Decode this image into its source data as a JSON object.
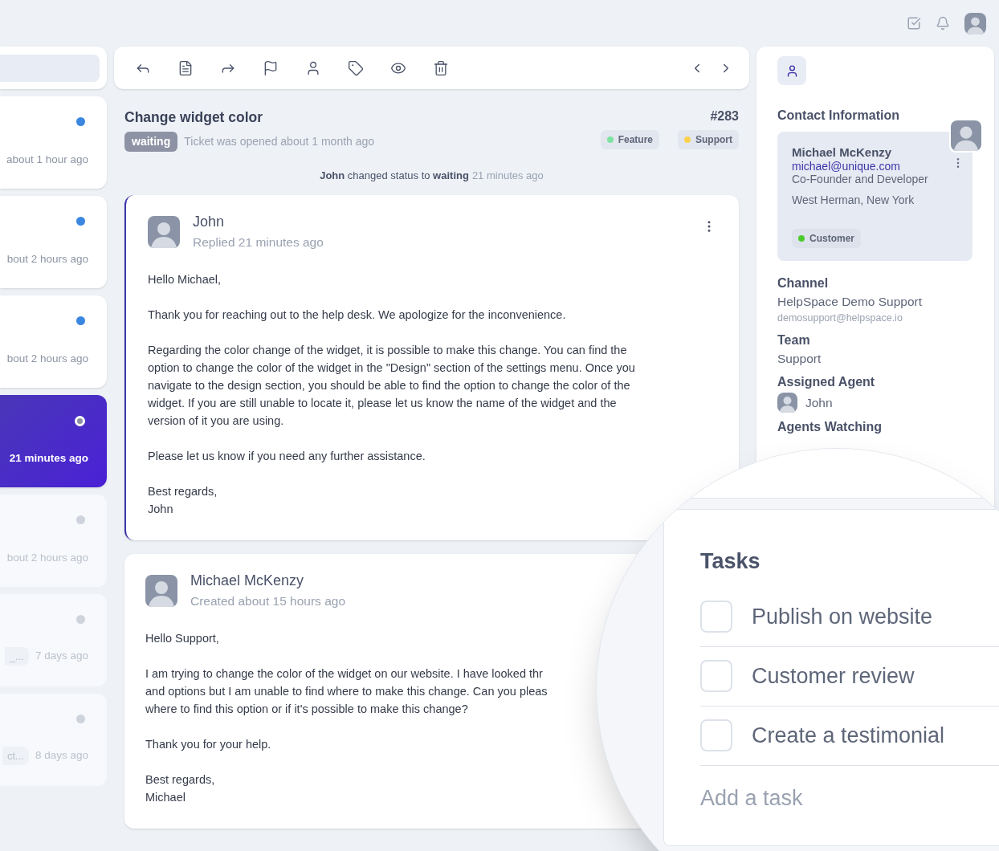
{
  "ticket_list": [
    {
      "time": "about 1 hour ago",
      "unread": true,
      "selected": false
    },
    {
      "time": "bout 2 hours ago",
      "unread": true,
      "selected": false
    },
    {
      "time": "bout 2 hours ago",
      "unread": true,
      "selected": false
    },
    {
      "time": "21 minutes ago",
      "unread": false,
      "selected": true
    },
    {
      "time": "bout 2 hours ago",
      "unread": false,
      "selected": false
    },
    {
      "time": "7 days ago",
      "chip": "_...",
      "unread": false,
      "selected": false
    },
    {
      "time": "8 days ago",
      "chip": "ct...",
      "unread": false,
      "selected": false
    }
  ],
  "ticket": {
    "title": "Change widget color",
    "status": "waiting",
    "opened": "Ticket was opened about 1 month ago",
    "number": "#283",
    "tags": [
      {
        "label": "Feature",
        "color": "#7ee2a0"
      },
      {
        "label": "Support",
        "color": "#fcd14d"
      }
    ]
  },
  "activity": {
    "text": "**John** changed status to **waiting**",
    "time": "21 minutes ago"
  },
  "messages": [
    {
      "kind": "reply",
      "author": "John",
      "time": "Replied 21 minutes ago",
      "paragraphs": [
        [
          "Hello Michael,"
        ],
        [
          "Thank you for reaching out to the help desk. We apologize for the inconvenience."
        ],
        [
          "Regarding the color change of the widget, it is possible to make this change. You can find the",
          "option to change the color of the widget in the \"Design\" section of the settings menu. Once you",
          "navigate to the design section, you should be able to find the option to change the color of the",
          "widget. If you are still unable to locate it, please let us know the name of the widget and the",
          "version of it you are using."
        ],
        [
          "Please let us know if you need any further assistance."
        ],
        [
          "Best regards,",
          "John"
        ]
      ]
    },
    {
      "kind": "customer",
      "author": "Michael McKenzy",
      "time": "Created about 15 hours ago",
      "paragraphs": [
        [
          "Hello Support,"
        ],
        [
          "I am trying to change the color of the widget on our website. I have looked thr",
          "and options but I am unable to find where to make this change. Can you pleas",
          "where to find this option or if it's possible to make this change?"
        ],
        [
          "Thank you for your help."
        ],
        [
          "Best regards,",
          "Michael"
        ]
      ]
    }
  ],
  "contact": {
    "title": "Contact Information",
    "name": "Michael McKenzy",
    "email": "michael@unique.com",
    "role": "Co-Founder and Developer",
    "location": "West Herman, New York",
    "tag": {
      "label": "Customer",
      "color": "#4ccb2f"
    }
  },
  "details": [
    {
      "kind": "text",
      "label": "Channel",
      "value": "HelpSpace Demo Support",
      "sub": "demosupport@helpspace.io"
    },
    {
      "kind": "text",
      "label": "Team",
      "value": "Support"
    },
    {
      "kind": "agent",
      "label": "Assigned Agent",
      "value": "John"
    },
    {
      "kind": "heading",
      "label": "Agents Watching"
    }
  ],
  "tasks": {
    "title": "Tasks",
    "items": [
      {
        "label": "Publish on website",
        "checked": false
      },
      {
        "label": "Customer review",
        "checked": false
      },
      {
        "label": "Create a testimonial",
        "checked": false
      }
    ],
    "placeholder": "Add a task"
  }
}
